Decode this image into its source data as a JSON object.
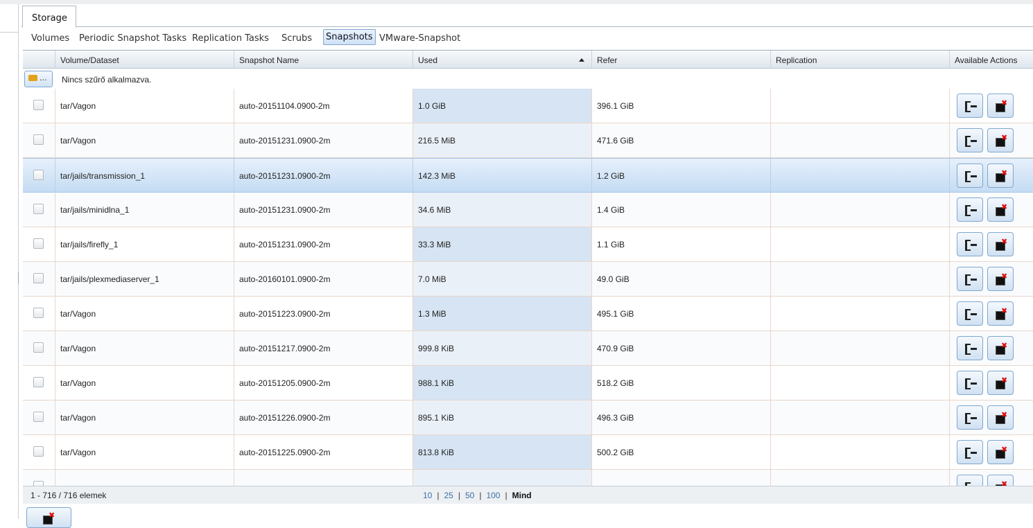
{
  "tabs": {
    "storage": "Storage"
  },
  "subnav": [
    {
      "label": "Volumes",
      "active": false
    },
    {
      "label": "Periodic Snapshot Tasks",
      "active": false
    },
    {
      "label": "Replication Tasks",
      "active": false
    },
    {
      "label": "Scrubs",
      "active": false
    },
    {
      "label": "Snapshots",
      "active": true
    },
    {
      "label": "VMware-Snapshot",
      "active": false
    }
  ],
  "columns": {
    "volume": "Volume/Dataset",
    "snapshot": "Snapshot Name",
    "used": "Used",
    "refer": "Refer",
    "replication": "Replication",
    "actions": "Available Actions"
  },
  "sort": {
    "column": "used",
    "direction": "ascending"
  },
  "filter": {
    "button_label": "...",
    "text": "Nincs szűrő alkalmazva."
  },
  "rows": [
    {
      "volume": "tar/Vagon",
      "snapshot": "auto-20151104.0900-2m",
      "used": "1.0 GiB",
      "refer": "396.1 GiB",
      "replication": "",
      "selected": false
    },
    {
      "volume": "tar/Vagon",
      "snapshot": "auto-20151231.0900-2m",
      "used": "216.5 MiB",
      "refer": "471.6 GiB",
      "replication": "",
      "selected": false
    },
    {
      "volume": "tar/jails/transmission_1",
      "snapshot": "auto-20151231.0900-2m",
      "used": "142.3 MiB",
      "refer": "1.2 GiB",
      "replication": "",
      "selected": true
    },
    {
      "volume": "tar/jails/minidlna_1",
      "snapshot": "auto-20151231.0900-2m",
      "used": "34.6 MiB",
      "refer": "1.4 GiB",
      "replication": "",
      "selected": false
    },
    {
      "volume": "tar/jails/firefly_1",
      "snapshot": "auto-20151231.0900-2m",
      "used": "33.3 MiB",
      "refer": "1.1 GiB",
      "replication": "",
      "selected": false
    },
    {
      "volume": "tar/jails/plexmediaserver_1",
      "snapshot": "auto-20160101.0900-2m",
      "used": "7.0 MiB",
      "refer": "49.0 GiB",
      "replication": "",
      "selected": false
    },
    {
      "volume": "tar/Vagon",
      "snapshot": "auto-20151223.0900-2m",
      "used": "1.3 MiB",
      "refer": "495.1 GiB",
      "replication": "",
      "selected": false
    },
    {
      "volume": "tar/Vagon",
      "snapshot": "auto-20151217.0900-2m",
      "used": "999.8 KiB",
      "refer": "470.9 GiB",
      "replication": "",
      "selected": false
    },
    {
      "volume": "tar/Vagon",
      "snapshot": "auto-20151205.0900-2m",
      "used": "988.1 KiB",
      "refer": "518.2 GiB",
      "replication": "",
      "selected": false
    },
    {
      "volume": "tar/Vagon",
      "snapshot": "auto-20151226.0900-2m",
      "used": "895.1 KiB",
      "refer": "496.3 GiB",
      "replication": "",
      "selected": false
    },
    {
      "volume": "tar/Vagon",
      "snapshot": "auto-20151225.0900-2m",
      "used": "813.8 KiB",
      "refer": "500.2 GiB",
      "replication": "",
      "selected": false
    },
    {
      "volume": "",
      "snapshot": "",
      "used": "",
      "refer": "",
      "replication": "",
      "selected": false
    }
  ],
  "row_actions": [
    "clone-icon",
    "delete-icon"
  ],
  "footer": {
    "count": "1 - 716 / 716 elemek",
    "page_sizes": [
      "10",
      "25",
      "50",
      "100"
    ],
    "all": "Mind"
  },
  "bulk_delete_icon": "delete-icon"
}
